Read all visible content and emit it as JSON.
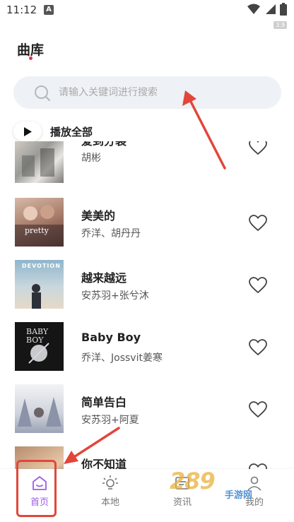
{
  "status_bar": {
    "time": "11:12",
    "badge": "A",
    "tag": "3.9"
  },
  "header": {
    "title": "曲库",
    "accent_color": "#e8334a"
  },
  "search": {
    "placeholder": "请输入关键词进行搜索"
  },
  "play_all": {
    "label": "播放全部"
  },
  "songs": [
    {
      "title": "爱到分裂",
      "artist": "胡彬"
    },
    {
      "title": "美美的",
      "artist": "乔洋、胡丹丹",
      "cover_text": "pretty"
    },
    {
      "title": "越来越远",
      "artist": "安苏羽+张兮沐",
      "cover_text": "DEVOTION"
    },
    {
      "title": "Baby Boy",
      "artist": "乔洋、Jossvit姜寒",
      "cover_text": "BABY BOY"
    },
    {
      "title": "简单告白",
      "artist": "安苏羽+阿夏"
    },
    {
      "title": "你不知道",
      "artist": ""
    }
  ],
  "bottom_nav": {
    "items": [
      {
        "label": "首页",
        "icon": "home-icon",
        "active": true
      },
      {
        "label": "本地",
        "icon": "bulb-icon",
        "active": false
      },
      {
        "label": "资讯",
        "icon": "news-icon",
        "active": false
      },
      {
        "label": "我的",
        "icon": "profile-icon",
        "active": false
      }
    ],
    "active_color": "#9b5de5"
  },
  "watermark": {
    "main": "289",
    "sub": "手游网"
  },
  "annotation_color": "#e2463a"
}
